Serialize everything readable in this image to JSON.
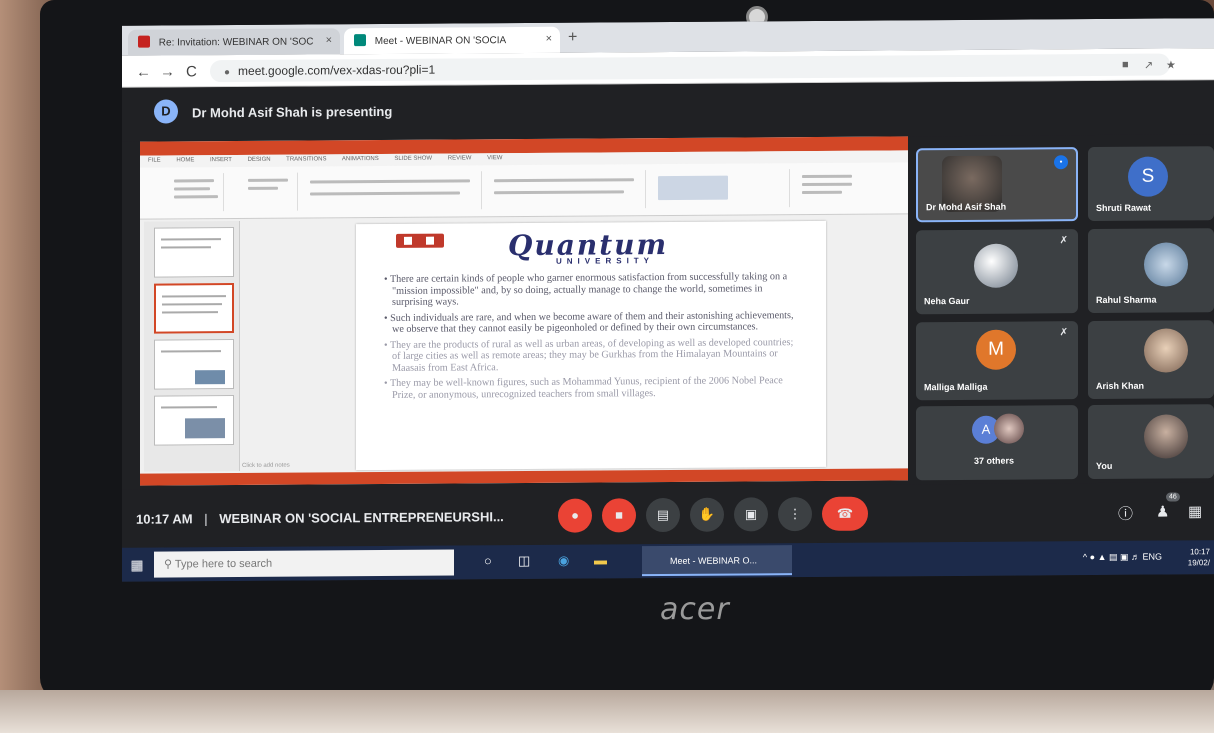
{
  "browser": {
    "tabs": [
      {
        "label": "Re: Invitation: WEBINAR ON 'SOC",
        "close": "×"
      },
      {
        "label": "Meet - WEBINAR ON 'SOCIA",
        "close": "×"
      }
    ],
    "new_tab": "+",
    "back": "←",
    "forward": "→",
    "reload": "C",
    "url": "meet.google.com/vex-xdas-rou?pli=1"
  },
  "meet": {
    "presenting_banner": "Dr Mohd Asif Shah is presenting",
    "presenter_initial": "D",
    "participants": [
      {
        "name": "Dr Mohd Asif Shah",
        "kind": "photo"
      },
      {
        "name": "Shruti Rawat",
        "kind": "initial",
        "initial": "S",
        "color": "#3f6fc9"
      },
      {
        "name": "Neha Gaur",
        "kind": "photo"
      },
      {
        "name": "Rahul Sharma",
        "kind": "photo"
      },
      {
        "name": "Malliga Malliga",
        "kind": "initial",
        "initial": "M",
        "color": "#e0772b"
      },
      {
        "name": "Arish Khan",
        "kind": "photo"
      },
      {
        "name": "37 others",
        "kind": "group",
        "initial": "A",
        "color": "#5b7fd6"
      },
      {
        "name": "You",
        "kind": "photo"
      }
    ],
    "bottom": {
      "time": "10:17 AM",
      "separator": "|",
      "meeting_title": "WEBINAR ON 'SOCIAL ENTREPRENEURSHI...",
      "people_count": "46"
    }
  },
  "slide": {
    "logo_main": "Quantum",
    "logo_sub": "UNIVERSITY",
    "bullets": [
      "There are certain kinds of people who garner enormous satisfaction from successfully taking on a \"mission impossible\" and, by so doing, actually manage to change the world, sometimes in surprising ways.",
      "Such individuals are rare, and when we become aware of them and their astonishing achievements, we observe that they cannot easily be pigeonholed or defined by their own circumstances.",
      "They are the products of rural as well as urban areas, of developing as well as developed countries; of large cities as well as remote areas; they may be Gurkhas from the Himalayan Mountains or Maasais from East Africa.",
      "They may be well-known figures, such as Mohammad Yunus, recipient of the 2006 Nobel Peace Prize, or anonymous, unrecognized teachers from small villages."
    ],
    "notes_placeholder": "Click to add notes",
    "ribbon_tabs": [
      "FILE",
      "HOME",
      "INSERT",
      "DESIGN",
      "TRANSITIONS",
      "ANIMATIONS",
      "SLIDE SHOW",
      "REVIEW",
      "VIEW"
    ]
  },
  "taskbar": {
    "search_placeholder": "Type here to search",
    "active_app": "Meet - WEBINAR O...",
    "lang": "ENG",
    "time": "10:17",
    "date": "19/02/"
  },
  "laptop_brand": "acer"
}
